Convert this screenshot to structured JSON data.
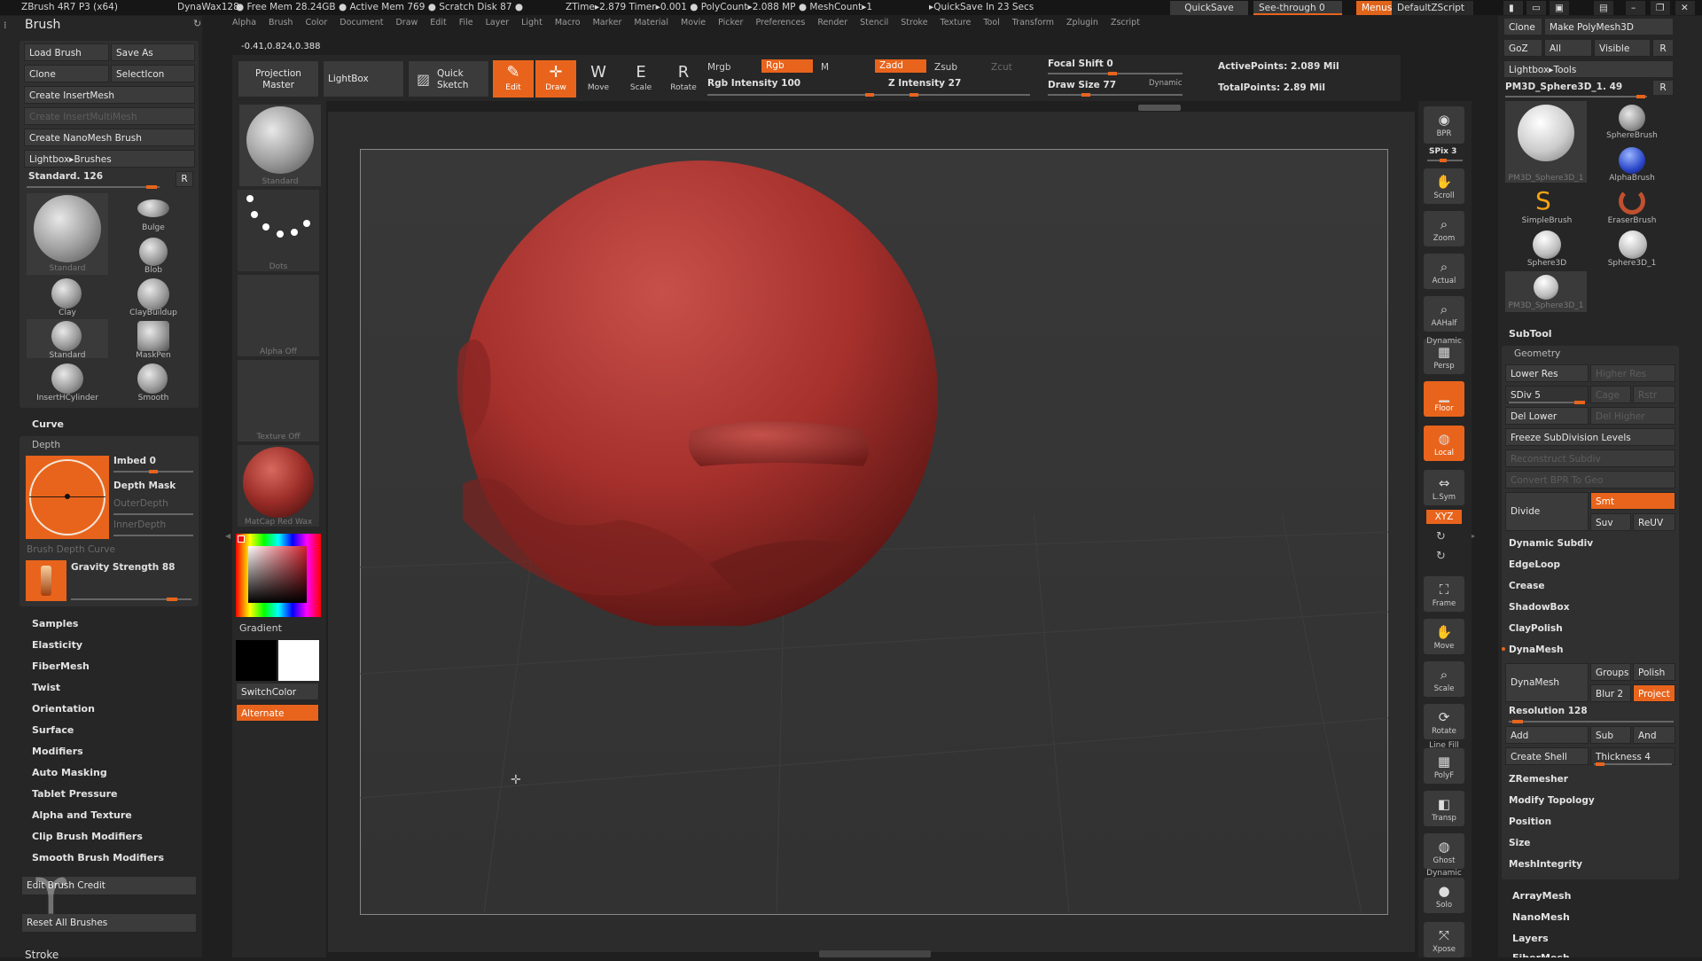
{
  "topbar": {
    "app": "ZBrush 4R7 P3 (x64)",
    "file": "DynaWax128",
    "stats": [
      "● Free Mem 28.24GB ● Active Mem 769 ● Scratch Disk 87 ●",
      "ZTime▸2.879 Timer▸0.001 ● PolyCount▸2.088 MP ● MeshCount▸1",
      "▸QuickSave In 23 Secs"
    ],
    "quicksave": "QuickSave",
    "seethrough": "See-through",
    "seethrough_val": "0",
    "menus": "Menus",
    "script": "DefaultZScript"
  },
  "menubar": [
    "Alpha",
    "Brush",
    "Color",
    "Document",
    "Draw",
    "Edit",
    "File",
    "Layer",
    "Light",
    "Macro",
    "Marker",
    "Material",
    "Movie",
    "Picker",
    "Preferences",
    "Render",
    "Stencil",
    "Stroke",
    "Texture",
    "Tool",
    "Transform",
    "Zplugin",
    "Zscript"
  ],
  "coords": "-0.41,0.824,0.388",
  "shelf": {
    "projection_master": "Projection Master",
    "lightbox": "LightBox",
    "quick_sketch": "Quick Sketch",
    "edit": "Edit",
    "draw": "Draw",
    "move": "Move",
    "scale": "Scale",
    "rotate": "Rotate",
    "mrgb": "Mrgb",
    "rgb": "Rgb",
    "m": "M",
    "rgb_intensity": "Rgb Intensity 100",
    "zadd": "Zadd",
    "zsub": "Zsub",
    "zcut": "Zcut",
    "z_intensity": "Z Intensity 27",
    "focal_shift": "Focal Shift 0",
    "draw_size": "Draw Size 77",
    "dynamic": "Dynamic",
    "active_points": "ActivePoints: 2.089 Mil",
    "total_points": "TotalPoints: 2.89 Mil",
    "rgb_intensity_pct": 100,
    "z_intensity_pct": 27,
    "focal_pct": 50,
    "draw_size_pct": 30
  },
  "brush_panel": {
    "title": "Brush",
    "load": "Load Brush",
    "save": "Save As",
    "clone": "Clone",
    "selecticon": "SelectIcon",
    "create_insert": "Create InsertMesh",
    "create_insertmulti": "Create InsertMultiMesh",
    "create_nano": "Create NanoMesh Brush",
    "lightbox_brushes": "Lightbox▸Brushes",
    "current": "Standard. 126",
    "r": "R",
    "thumbs": [
      "Standard",
      "Bulge",
      "Blob",
      "Clay",
      "ClayBuildup",
      "Standard",
      "MaskPen",
      "InsertHCylinder",
      "Smooth"
    ],
    "curve": "Curve",
    "depth": "Depth",
    "imbed": "Imbed 0",
    "depth_mask": "Depth Mask",
    "outer_depth": "OuterDepth",
    "inner_depth": "InnerDepth",
    "brush_depth_curve": "Brush Depth Curve",
    "gravity": "Gravity Strength 88",
    "items": [
      "Samples",
      "Elasticity",
      "FiberMesh",
      "Twist",
      "Orientation",
      "Surface",
      "Modifiers",
      "Auto Masking",
      "Tablet Pressure",
      "Alpha and Texture",
      "Clip Brush Modifiers",
      "Smooth Brush Modifiers"
    ],
    "edit_credit": "Edit Brush Credit",
    "reset": "Reset All Brushes",
    "stroke": "Stroke"
  },
  "left_strip": {
    "standard": "Standard",
    "dots": "Dots",
    "alpha_off": "Alpha Off",
    "texture_off": "Texture Off",
    "matcap": "MatCap Red Wax",
    "gradient": "Gradient",
    "switchcolor": "SwitchColor",
    "alternate": "Alternate"
  },
  "right_tools": [
    {
      "id": "bpr",
      "label": "BPR",
      "icon": "bpr-icon",
      "glyph": "◉"
    },
    {
      "id": "scroll",
      "label": "Scroll",
      "icon": "hand-icon",
      "glyph": "✋"
    },
    {
      "id": "zoom",
      "label": "Zoom",
      "icon": "zoom-icon",
      "glyph": "⌕"
    },
    {
      "id": "actual",
      "label": "Actual",
      "icon": "actual-icon",
      "glyph": "⌕"
    },
    {
      "id": "aahalf",
      "label": "AAHalf",
      "icon": "aahalf-icon",
      "glyph": "⌕"
    },
    {
      "id": "persp",
      "label": "Persp",
      "icon": "persp-icon",
      "glyph": "▦"
    },
    {
      "id": "floor",
      "label": "Floor",
      "icon": "floor-icon",
      "glyph": "▁"
    },
    {
      "id": "local",
      "label": "Local",
      "icon": "local-icon",
      "glyph": "◍"
    },
    {
      "id": "lsym",
      "label": "L.Sym",
      "icon": "lsym-icon",
      "glyph": "⇔"
    },
    {
      "id": "frame",
      "label": "Frame",
      "icon": "frame-icon",
      "glyph": "⛶"
    },
    {
      "id": "move",
      "label": "Move",
      "icon": "move-icon",
      "glyph": "✋"
    },
    {
      "id": "scale",
      "label": "Scale",
      "icon": "scale-icon",
      "glyph": "⌕"
    },
    {
      "id": "rotate",
      "label": "Rotate",
      "icon": "rotate-icon",
      "glyph": "⟳"
    },
    {
      "id": "polyf",
      "label": "PolyF",
      "icon": "polyf-icon",
      "glyph": "▦"
    },
    {
      "id": "transp",
      "label": "Transp",
      "icon": "transp-icon",
      "glyph": "◧"
    },
    {
      "id": "ghost",
      "label": "Ghost",
      "icon": "ghost-icon",
      "glyph": "◍"
    },
    {
      "id": "solo",
      "label": "Solo",
      "icon": "solo-icon",
      "glyph": "●"
    },
    {
      "id": "xpose",
      "label": "Xpose",
      "icon": "xpose-icon",
      "glyph": "⤧"
    }
  ],
  "right_tool_extra": {
    "spix": "SPix 3",
    "dynamic": "Dynamic",
    "xyz": "XYZ",
    "linefill": "Line Fill",
    "dynamic2": "Dynamic"
  },
  "tool_panel": {
    "clone": "Clone",
    "make_polymesh": "Make PolyMesh3D",
    "goz": "GoZ",
    "all": "All",
    "visible": "Visible",
    "r": "R",
    "lightbox_tools": "Lightbox▸Tools",
    "current": "PM3D_Sphere3D_1. 49",
    "r2": "R",
    "thumbs": [
      "PM3D_Sphere3D_1",
      "SphereBrush",
      "AlphaBrush",
      "SimpleBrush",
      "EraserBrush",
      "Sphere3D",
      "Sphere3D_1",
      "PM3D_Sphere3D_1"
    ],
    "subtool": "SubTool",
    "geometry": "Geometry",
    "lower_res": "Lower Res",
    "higher_res": "Higher Res",
    "sdiv": "SDiv 5",
    "cage": "Cage",
    "rstr": "Rstr",
    "del_lower": "Del Lower",
    "del_higher": "Del Higher",
    "freeze": "Freeze SubDivision Levels",
    "reconstruct": "Reconstruct Subdiv",
    "convert_bpr": "Convert BPR To Geo",
    "divide": "Divide",
    "smt": "Smt",
    "suv": "Suv",
    "reuv": "ReUV",
    "items1": [
      "Dynamic Subdiv",
      "EdgeLoop",
      "Crease",
      "ShadowBox",
      "ClayPolish",
      "DynaMesh"
    ],
    "dynamesh": "DynaMesh",
    "groups": "Groups",
    "polish": "Polish",
    "blur": "Blur 2",
    "project": "Project",
    "resolution": "Resolution 128",
    "add": "Add",
    "sub": "Sub",
    "and": "And",
    "create_shell": "Create Shell",
    "thickness": "Thickness 4",
    "items2": [
      "ZRemesher",
      "Modify Topology",
      "Position",
      "Size",
      "MeshIntegrity"
    ],
    "items3": [
      "ArrayMesh",
      "NanoMesh",
      "Layers",
      "FiberMesh"
    ]
  },
  "colors": {
    "orange": "#e8641c",
    "sphere": "#a8312e"
  }
}
